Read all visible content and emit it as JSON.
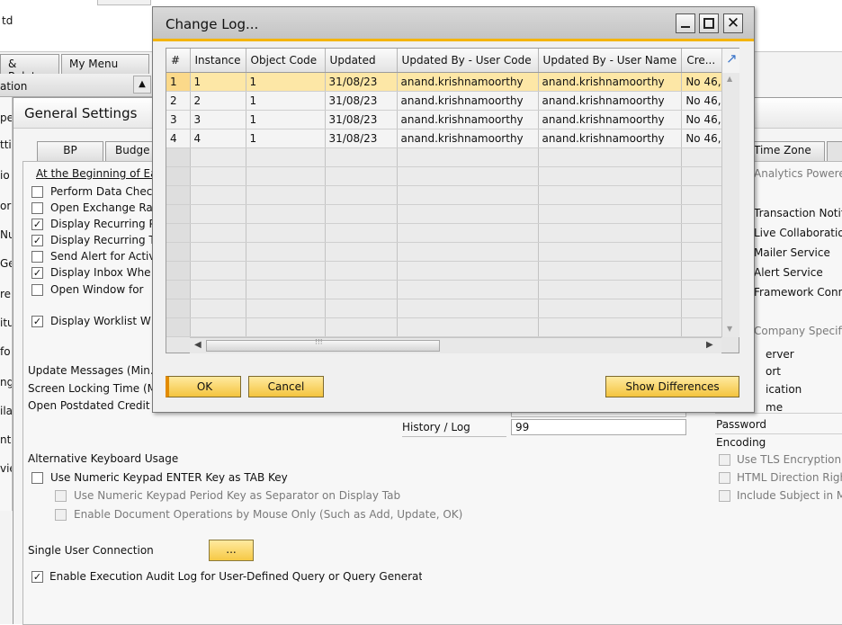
{
  "background": {
    "partial_title": "td",
    "tabs": [
      "& Relate",
      "My Menu"
    ],
    "strip_label": "ation"
  },
  "general_settings": {
    "title": "General Settings",
    "tabs": [
      "BP",
      "Budge",
      "Time Zone"
    ],
    "section_beginning": "At the Beginning of Ea",
    "checkboxes": [
      {
        "label": "Perform Data Chec",
        "checked": false
      },
      {
        "label": "Open Exchange Ra",
        "checked": false
      },
      {
        "label": "Display Recurring P",
        "checked": true
      },
      {
        "label": "Display Recurring T",
        "checked": true
      },
      {
        "label": "Send Alert for Activ",
        "checked": false
      },
      {
        "label": "Display Inbox Whe",
        "checked": true
      },
      {
        "label": "Open Window for",
        "checked": false
      }
    ],
    "worklist": {
      "label": "Display Worklist W",
      "checked": true
    },
    "labels": {
      "update_messages": "Update Messages (Min.)",
      "screen_locking": "Screen Locking Time (M",
      "postdated_credit": "Open Postdated Credit",
      "history_log": "History / Log"
    },
    "history_log_value": "99",
    "keyboard": {
      "title": "Alternative Keyboard Usage",
      "numeric_enter": "Use Numeric Keypad ENTER Key as TAB Key",
      "numeric_period": "Use Numeric Keypad Period Key as Separator on Display Tab",
      "mouse_only": "Enable Document Operations by Mouse Only (Such as Add, Update, OK)"
    },
    "single_user": "Single User Connection",
    "single_user_button": "...",
    "audit_log": "Enable Execution Audit Log for User-Defined Query or Query Generato",
    "right_panel": {
      "analytics": "Analytics Powere",
      "services": [
        "Transaction Notif",
        "Live Collaboration",
        "Mailer Service",
        "Alert Service",
        "Framework Conn"
      ],
      "company_specific": "Company Specifi",
      "fields": [
        "erver",
        "ort",
        "ication",
        "me",
        "Password",
        "Encoding"
      ],
      "options": [
        "Use TLS Encryption",
        "HTML Direction Righ",
        "Include Subject in M"
      ]
    },
    "edge_labels": [
      "pe",
      "tti",
      "io",
      "or",
      "Nu",
      "Ge",
      "re",
      "itu",
      "fo",
      "ng",
      "ila",
      "nti",
      "vie"
    ]
  },
  "change_log": {
    "title": "Change Log...",
    "columns": [
      "#",
      "Instance",
      "Object Code",
      "Updated",
      "Updated By - User Code",
      "Updated By - User Name",
      "Cre..."
    ],
    "rows": [
      [
        "1",
        "1",
        "1",
        "31/08/23",
        "anand.krishnamoorthy",
        "anand.krishnamoorthy",
        "No 46,"
      ],
      [
        "2",
        "2",
        "1",
        "31/08/23",
        "anand.krishnamoorthy",
        "anand.krishnamoorthy",
        "No 46,"
      ],
      [
        "3",
        "3",
        "1",
        "31/08/23",
        "anand.krishnamoorthy",
        "anand.krishnamoorthy",
        "No 46,"
      ],
      [
        "4",
        "4",
        "1",
        "31/08/23",
        "anand.krishnamoorthy",
        "anand.krishnamoorthy",
        "No 46,"
      ]
    ],
    "selected_row": 0,
    "buttons": {
      "ok": "OK",
      "cancel": "Cancel",
      "show_differences": "Show Differences"
    }
  },
  "colors": {
    "accent": "#f4b400",
    "selected_row": "#fde7a6",
    "button": "#f6c945"
  }
}
